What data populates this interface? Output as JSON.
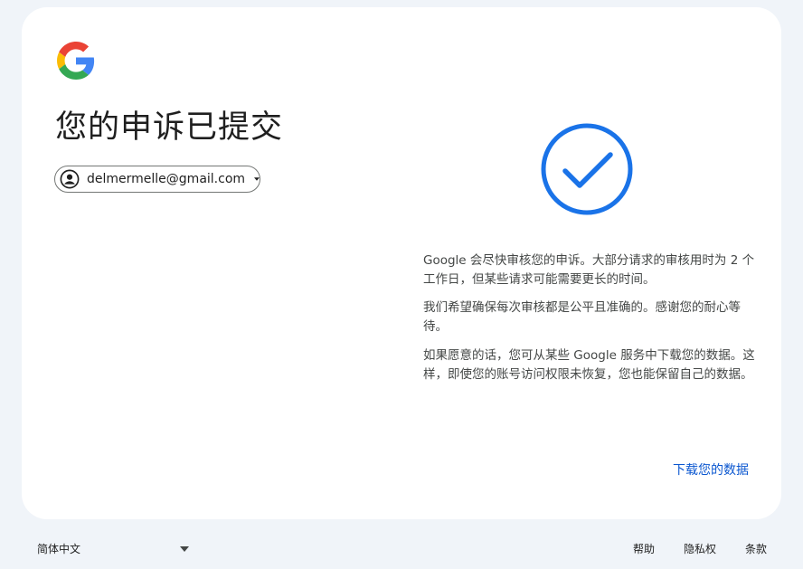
{
  "page": {
    "title": "您的申诉已提交"
  },
  "account": {
    "email": "delmermelle@gmail.com"
  },
  "message": {
    "paragraph1": "Google 会尽快审核您的申诉。大部分请求的审核用时为 2 个工作日，但某些请求可能需要更长的时间。",
    "paragraph2": "我们希望确保每次审核都是公平且准确的。感谢您的耐心等待。",
    "paragraph3": "如果愿意的话，您可从某些 Google 服务中下载您的数据。这样，即使您的账号访问权限未恢复，您也能保留自己的数据。"
  },
  "actions": {
    "download_label": "下载您的数据"
  },
  "footer": {
    "language": "简体中文",
    "links": [
      "帮助",
      "隐私权",
      "条款"
    ]
  },
  "icons": {
    "logo": "google-logo-icon",
    "account": "account-circle-icon",
    "caret": "caret-down-icon",
    "success": "check-circle-icon"
  },
  "colors": {
    "background": "#f0f4f9",
    "card": "#ffffff",
    "accent": "#0b57d0",
    "check": "#1a73e8",
    "text_primary": "#1f1f1f",
    "text_secondary": "#444746",
    "google_blue": "#4285F4",
    "google_red": "#EA4335",
    "google_yellow": "#FBBC05",
    "google_green": "#34A853"
  }
}
